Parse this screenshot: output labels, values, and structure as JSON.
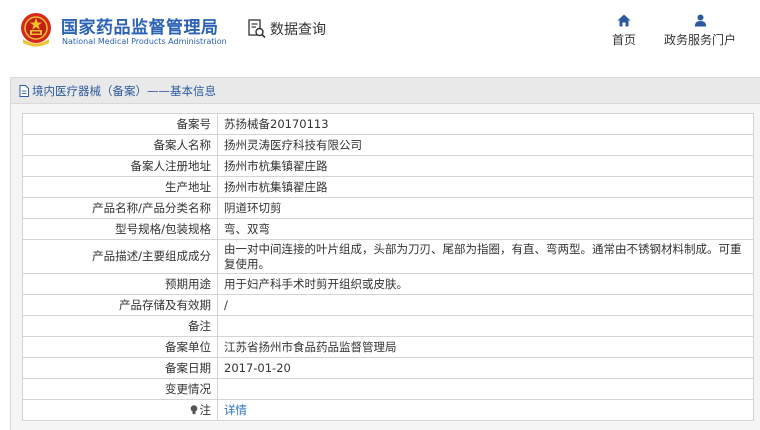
{
  "header": {
    "brand_cn": "国家药品监督管理局",
    "brand_en": "National Medical Products Administration",
    "query_label": "数据查询",
    "nav": {
      "home_label": "首页",
      "service_label": "政务服务门户"
    }
  },
  "panel": {
    "title": "境内医疗器械（备案）——基本信息"
  },
  "rows": [
    {
      "label": "备案号",
      "value": "苏扬械备20170113"
    },
    {
      "label": "备案人名称",
      "value": "扬州灵涛医疗科技有限公司"
    },
    {
      "label": "备案人注册地址",
      "value": "扬州市杭集镇翟庄路"
    },
    {
      "label": "生产地址",
      "value": "扬州市杭集镇翟庄路"
    },
    {
      "label": "产品名称/产品分类名称",
      "value": "阴道环切剪"
    },
    {
      "label": "型号规格/包装规格",
      "value": "弯、双弯"
    },
    {
      "label": "产品描述/主要组成成分",
      "value": "由一对中间连接的叶片组成，头部为刀刃、尾部为指圈，有直、弯两型。通常由不锈钢材料制成。可重复使用。"
    },
    {
      "label": "预期用途",
      "value": "用于妇产科手术时剪开组织或皮肤。"
    },
    {
      "label": "产品存储及有效期",
      "value": "/"
    },
    {
      "label": "备注",
      "value": ""
    },
    {
      "label": "备案单位",
      "value": "江苏省扬州市食品药品监督管理局"
    },
    {
      "label": "备案日期",
      "value": "2017-01-20"
    },
    {
      "label": "变更情况",
      "value": ""
    },
    {
      "label": "注",
      "value": "详情"
    }
  ],
  "colors": {
    "brand_blue": "#2b62b4",
    "link_blue": "#2b6fc0",
    "emblem_red": "#d8281c",
    "emblem_gold": "#f2c230"
  },
  "icons": [
    "national-emblem-icon",
    "data-query-icon",
    "home-icon",
    "user-icon",
    "document-icon",
    "lightbulb-icon"
  ]
}
